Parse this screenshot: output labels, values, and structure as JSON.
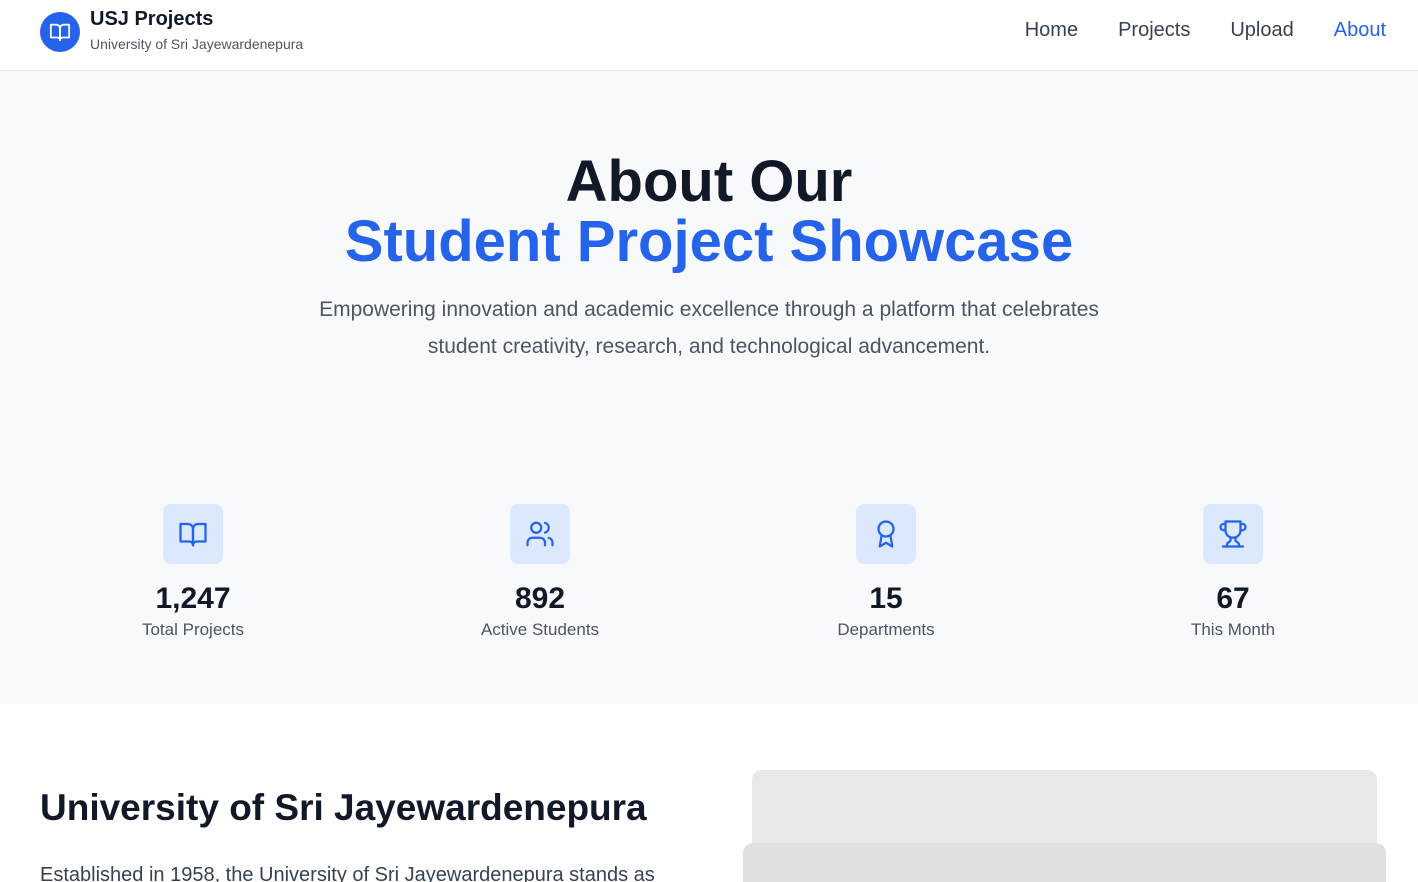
{
  "header": {
    "brand_title": "USJ Projects",
    "brand_subtitle": "University of Sri Jayewardenepura",
    "nav": [
      {
        "label": "Home",
        "active": false
      },
      {
        "label": "Projects",
        "active": false
      },
      {
        "label": "Upload",
        "active": false
      },
      {
        "label": "About",
        "active": true
      }
    ]
  },
  "hero": {
    "title_line1": "About Our",
    "title_line2": "Student Project Showcase",
    "description": "Empowering innovation and academic excellence through a platform that celebrates student creativity, research, and technological advancement."
  },
  "stats": [
    {
      "icon": "book-open-icon",
      "value": "1,247",
      "label": "Total Projects"
    },
    {
      "icon": "users-icon",
      "value": "892",
      "label": "Active Students"
    },
    {
      "icon": "award-icon",
      "value": "15",
      "label": "Departments"
    },
    {
      "icon": "trophy-icon",
      "value": "67",
      "label": "This Month"
    }
  ],
  "about": {
    "heading": "University of Sri Jayewardenepura",
    "paragraph": "Established in 1958, the University of Sri Jayewardenepura stands as"
  },
  "colors": {
    "accent": "#2563eb",
    "hero_bg": "#f8f9fb",
    "icon_bg": "#dbe8fe"
  }
}
